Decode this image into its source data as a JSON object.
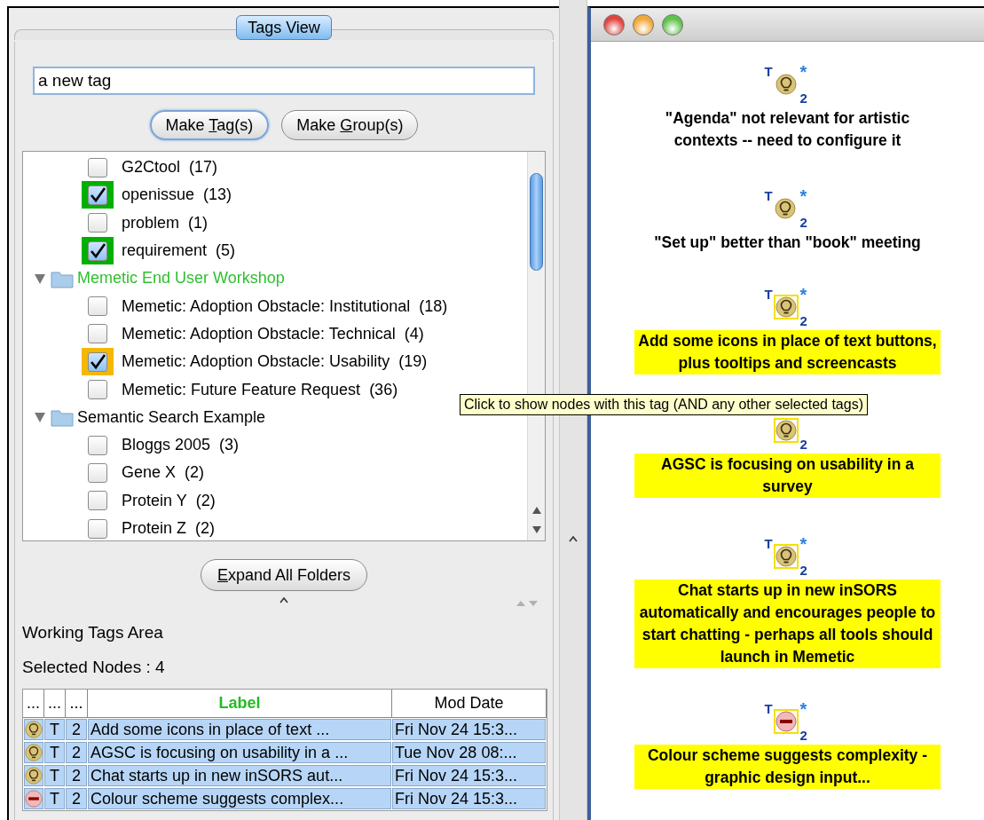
{
  "panel_title": "Tags View",
  "tag_input": {
    "value": "a new tag"
  },
  "make_buttons": [
    {
      "label": "Make Tag(s)",
      "focused": true
    },
    {
      "label": "Make Group(s)",
      "focused": false
    }
  ],
  "tree": [
    {
      "kind": "tag",
      "label": "G2Ctool",
      "count": "(17)",
      "checked": false
    },
    {
      "kind": "tag",
      "label": "openissue",
      "count": "(13)",
      "checked": true,
      "color": "#00b000"
    },
    {
      "kind": "tag",
      "label": "problem",
      "count": "(1)",
      "checked": false
    },
    {
      "kind": "tag",
      "label": "requirement",
      "count": "(5)",
      "checked": true,
      "color": "#00b000"
    },
    {
      "kind": "folder",
      "label": "Memetic End User Workshop",
      "expanded": true,
      "highlighted": true,
      "children": [
        {
          "kind": "tag",
          "label": "Memetic: Adoption Obstacle: Institutional",
          "count": "(18)",
          "checked": false
        },
        {
          "kind": "tag",
          "label": "Memetic: Adoption Obstacle: Technical",
          "count": "(4)",
          "checked": false
        },
        {
          "kind": "tag",
          "label": "Memetic: Adoption Obstacle: Usability",
          "count": "(19)",
          "checked": true,
          "color": "#f5b800"
        },
        {
          "kind": "tag",
          "label": "Memetic: Future Feature Request",
          "count": "(36)",
          "checked": false
        }
      ]
    },
    {
      "kind": "folder",
      "label": "Semantic Search Example",
      "expanded": true,
      "highlighted": false,
      "children": [
        {
          "kind": "tag",
          "label": "Bloggs 2005",
          "count": "(3)",
          "checked": false
        },
        {
          "kind": "tag",
          "label": "Gene X",
          "count": "(2)",
          "checked": false
        },
        {
          "kind": "tag",
          "label": "Protein Y",
          "count": "(2)",
          "checked": false
        },
        {
          "kind": "tag",
          "label": "Protein Z",
          "count": "(2)",
          "checked": false
        }
      ]
    }
  ],
  "expand_button": {
    "label": "Expand All Folders"
  },
  "working_area_title": "Working Tags Area",
  "selected_nodes": "Selected Nodes : 4",
  "table": {
    "columns": [
      {
        "label": "...",
        "sorted": false
      },
      {
        "label": "...",
        "sorted": false
      },
      {
        "label": "...",
        "sorted": false
      },
      {
        "label": "Label",
        "sorted": true
      },
      {
        "label": "Mod Date",
        "sorted": false
      }
    ],
    "rows": [
      {
        "kind": "idea",
        "type": "T",
        "count": "2",
        "label": "Add some icons in place of text ...",
        "date": "Fri Nov 24 15:3...",
        "selected": true
      },
      {
        "kind": "idea",
        "type": "T",
        "count": "2",
        "label": "AGSC is focusing on usability in a ...",
        "date": "Tue Nov 28 08:...",
        "selected": true
      },
      {
        "kind": "idea",
        "type": "T",
        "count": "2",
        "label": "Chat starts up in new inSORS aut...",
        "date": "Fri Nov 24 15:3...",
        "selected": true
      },
      {
        "kind": "con",
        "type": "T",
        "count": "2",
        "label": "Colour scheme suggests complex...",
        "date": "Fri Nov 24 15:3...",
        "selected": true
      }
    ]
  },
  "tooltip": "Click to show nodes with this tag (AND any other selected tags)",
  "nodes": [
    {
      "kind": "idea",
      "type": "T",
      "star": "*",
      "count": "2",
      "label": "\"Agenda\" not relevant for artistic contexts -- need to configure it",
      "highlighted": false
    },
    {
      "kind": "idea",
      "type": "T",
      "star": "*",
      "count": "2",
      "label": "\"Set up\" better than \"book\" meeting",
      "highlighted": false
    },
    {
      "kind": "idea",
      "type": "T",
      "star": "*",
      "count": "2",
      "label": "Add some icons in place of text buttons, plus tooltips and screencasts",
      "highlighted": true
    },
    {
      "kind": "idea",
      "count": "2",
      "label": "AGSC is focusing on usability in a survey",
      "highlighted": true
    },
    {
      "kind": "idea",
      "type": "T",
      "star": "*",
      "count": "2",
      "label": "Chat starts up in new inSORS automatically and encourages people to start chatting - perhaps all tools should launch in Memetic",
      "highlighted": true
    },
    {
      "kind": "con",
      "type": "T",
      "star": "*",
      "count": "2",
      "label": "Colour scheme suggests complexity - graphic design input...",
      "highlighted": true
    }
  ]
}
